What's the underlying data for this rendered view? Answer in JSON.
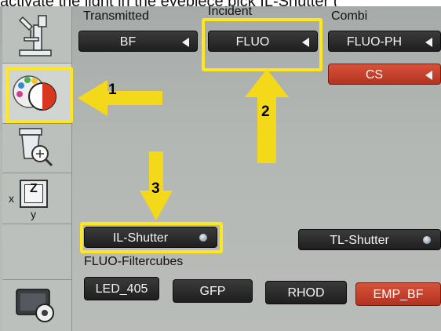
{
  "caption": "activate the light in the eyepiece pick IL-Shutter (",
  "groups": {
    "transmitted": "Transmitted",
    "incident": "Incident",
    "combi": "Combi",
    "filtercubes": "FLUO-Filtercubes"
  },
  "buttons": {
    "transmitted": "BF",
    "incident": "FLUO",
    "combi": "FLUO-PH",
    "cs": "CS",
    "il_shutter": "IL-Shutter",
    "tl_shutter": "TL-Shutter"
  },
  "filtercubes": [
    "LED_405",
    "GFP",
    "RHOD",
    "EMP_BF"
  ],
  "sidebar": {
    "axis_x": "x",
    "axis_y": "y",
    "axis_z": "Z"
  },
  "annotations": {
    "arrow1": "1",
    "arrow2": "2",
    "arrow3": "3"
  },
  "colors": {
    "highlight": "#ffe71a",
    "button_dark": "#2a2a2a",
    "button_red": "#c5412c",
    "arrow_fill": "#f4d81a"
  }
}
